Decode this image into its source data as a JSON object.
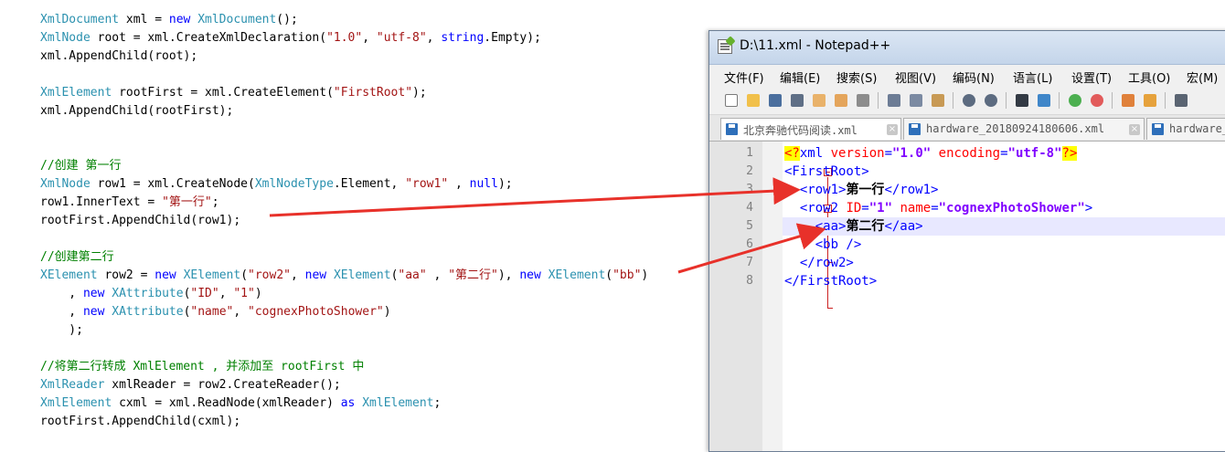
{
  "code_editor": {
    "lines": [
      [
        {
          "c": "type",
          "t": "XmlDocument"
        },
        {
          "c": "txt",
          "t": " xml = "
        },
        {
          "c": "kw",
          "t": "new"
        },
        {
          "c": "txt",
          "t": " "
        },
        {
          "c": "type",
          "t": "XmlDocument"
        },
        {
          "c": "txt",
          "t": "();"
        }
      ],
      [
        {
          "c": "type",
          "t": "XmlNode"
        },
        {
          "c": "txt",
          "t": " root = xml.CreateXmlDeclaration("
        },
        {
          "c": "str",
          "t": "\"1.0\""
        },
        {
          "c": "txt",
          "t": ", "
        },
        {
          "c": "str",
          "t": "\"utf-8\""
        },
        {
          "c": "txt",
          "t": ", "
        },
        {
          "c": "kw",
          "t": "string"
        },
        {
          "c": "txt",
          "t": ".Empty);"
        }
      ],
      [
        {
          "c": "txt",
          "t": "xml.AppendChild(root);"
        }
      ],
      [],
      [
        {
          "c": "type",
          "t": "XmlElement"
        },
        {
          "c": "txt",
          "t": " rootFirst = xml.CreateElement("
        },
        {
          "c": "str",
          "t": "\"FirstRoot\""
        },
        {
          "c": "txt",
          "t": ");"
        }
      ],
      [
        {
          "c": "txt",
          "t": "xml.AppendChild(rootFirst);"
        }
      ],
      [],
      [],
      [
        {
          "c": "cmt",
          "t": "//创建 第一行"
        }
      ],
      [
        {
          "c": "type",
          "t": "XmlNode"
        },
        {
          "c": "txt",
          "t": " row1 = xml.CreateNode("
        },
        {
          "c": "type",
          "t": "XmlNodeType"
        },
        {
          "c": "txt",
          "t": ".Element, "
        },
        {
          "c": "str",
          "t": "\"row1\""
        },
        {
          "c": "txt",
          "t": " , "
        },
        {
          "c": "kw",
          "t": "null"
        },
        {
          "c": "txt",
          "t": ");"
        }
      ],
      [
        {
          "c": "txt",
          "t": "row1.InnerText = "
        },
        {
          "c": "str",
          "t": "\"第一行\""
        },
        {
          "c": "txt",
          "t": ";"
        }
      ],
      [
        {
          "c": "txt",
          "t": "rootFirst.AppendChild(row1);"
        }
      ],
      [],
      [
        {
          "c": "cmt",
          "t": "//创建第二行"
        }
      ],
      [
        {
          "c": "type",
          "t": "XElement"
        },
        {
          "c": "txt",
          "t": " row2 = "
        },
        {
          "c": "kw",
          "t": "new"
        },
        {
          "c": "txt",
          "t": " "
        },
        {
          "c": "type",
          "t": "XElement"
        },
        {
          "c": "txt",
          "t": "("
        },
        {
          "c": "str",
          "t": "\"row2\""
        },
        {
          "c": "txt",
          "t": ", "
        },
        {
          "c": "kw",
          "t": "new"
        },
        {
          "c": "txt",
          "t": " "
        },
        {
          "c": "type",
          "t": "XElement"
        },
        {
          "c": "txt",
          "t": "("
        },
        {
          "c": "str",
          "t": "\"aa\""
        },
        {
          "c": "txt",
          "t": " , "
        },
        {
          "c": "str",
          "t": "\"第二行\""
        },
        {
          "c": "txt",
          "t": "), "
        },
        {
          "c": "kw",
          "t": "new"
        },
        {
          "c": "txt",
          "t": " "
        },
        {
          "c": "type",
          "t": "XElement"
        },
        {
          "c": "txt",
          "t": "("
        },
        {
          "c": "str",
          "t": "\"bb\""
        },
        {
          "c": "txt",
          "t": ")"
        }
      ],
      [
        {
          "c": "txt",
          "t": "    , "
        },
        {
          "c": "kw",
          "t": "new"
        },
        {
          "c": "txt",
          "t": " "
        },
        {
          "c": "type",
          "t": "XAttribute"
        },
        {
          "c": "txt",
          "t": "("
        },
        {
          "c": "str",
          "t": "\"ID\""
        },
        {
          "c": "txt",
          "t": ", "
        },
        {
          "c": "str",
          "t": "\"1\""
        },
        {
          "c": "txt",
          "t": ")"
        }
      ],
      [
        {
          "c": "txt",
          "t": "    , "
        },
        {
          "c": "kw",
          "t": "new"
        },
        {
          "c": "txt",
          "t": " "
        },
        {
          "c": "type",
          "t": "XAttribute"
        },
        {
          "c": "txt",
          "t": "("
        },
        {
          "c": "str",
          "t": "\"name\""
        },
        {
          "c": "txt",
          "t": ", "
        },
        {
          "c": "str",
          "t": "\"cognexPhotoShower\""
        },
        {
          "c": "txt",
          "t": ")"
        }
      ],
      [
        {
          "c": "txt",
          "t": "    );"
        }
      ],
      [],
      [
        {
          "c": "cmt",
          "t": "//将第二行转成 XmlElement , 并添加至 rootFirst 中"
        }
      ],
      [
        {
          "c": "type",
          "t": "XmlReader"
        },
        {
          "c": "txt",
          "t": " xmlReader = row2.CreateReader();"
        }
      ],
      [
        {
          "c": "type",
          "t": "XmlElement"
        },
        {
          "c": "txt",
          "t": " cxml = xml.ReadNode(xmlReader) "
        },
        {
          "c": "kw",
          "t": "as"
        },
        {
          "c": "txt",
          "t": " "
        },
        {
          "c": "type",
          "t": "XmlElement"
        },
        {
          "c": "txt",
          "t": ";"
        }
      ],
      [
        {
          "c": "txt",
          "t": "rootFirst.AppendChild(cxml);"
        }
      ]
    ]
  },
  "notepad": {
    "title": "D:\\11.xml - Notepad++",
    "menu": [
      "文件(F)",
      "编辑(E)",
      "搜索(S)",
      "视图(V)",
      "编码(N)",
      "语言(L)",
      "设置(T)",
      "工具(O)",
      "宏(M)"
    ],
    "toolbar_icons": [
      "new-file-icon",
      "open-file-icon",
      "save-icon",
      "save-all-icon",
      "close-icon",
      "close-all-icon",
      "print-icon",
      "cut-icon",
      "copy-icon",
      "paste-icon",
      "undo-icon",
      "redo-icon",
      "find-icon",
      "replace-icon",
      "zoom-in-icon",
      "zoom-out-icon",
      "sync-v-icon",
      "sync-h-icon",
      "wrap-icon"
    ],
    "tabs": [
      {
        "label": "北京奔驰代码阅读.xml",
        "close": "×"
      },
      {
        "label": "hardware_20180924180606.xml",
        "close": "×"
      },
      {
        "label": "hardware_"
      }
    ],
    "line_numbers": [
      "1",
      "2",
      "3",
      "4",
      "5",
      "6",
      "7",
      "8"
    ],
    "xml_lines": [
      [
        {
          "c": "decl",
          "t": "<?"
        },
        {
          "c": "tag",
          "t": "xml"
        },
        {
          "c": "txt",
          "t": " "
        },
        {
          "c": "attr",
          "t": "version"
        },
        {
          "c": "tag",
          "t": "="
        },
        {
          "c": "val",
          "t": "\"1.0\""
        },
        {
          "c": "txt",
          "t": " "
        },
        {
          "c": "attr",
          "t": "encoding"
        },
        {
          "c": "tag",
          "t": "="
        },
        {
          "c": "val",
          "t": "\"utf-8\""
        },
        {
          "c": "decl",
          "t": "?>"
        }
      ],
      [
        {
          "c": "tag",
          "t": "<FirstRoot>"
        }
      ],
      [
        {
          "c": "txt",
          "t": "  "
        },
        {
          "c": "tag",
          "t": "<row1>"
        },
        {
          "c": "text",
          "t": "第一行"
        },
        {
          "c": "tag",
          "t": "</row1>"
        }
      ],
      [
        {
          "c": "txt",
          "t": "  "
        },
        {
          "c": "tag",
          "t": "<row2 "
        },
        {
          "c": "attr",
          "t": "ID"
        },
        {
          "c": "tag",
          "t": "="
        },
        {
          "c": "val",
          "t": "\"1\""
        },
        {
          "c": "txt",
          "t": " "
        },
        {
          "c": "attr",
          "t": "name"
        },
        {
          "c": "tag",
          "t": "="
        },
        {
          "c": "val",
          "t": "\"cognexPhotoShower\""
        },
        {
          "c": "tag",
          "t": ">"
        }
      ],
      [
        {
          "c": "txt",
          "t": "    "
        },
        {
          "c": "tag",
          "t": "<aa>"
        },
        {
          "c": "text",
          "t": "第二行"
        },
        {
          "c": "tag",
          "t": "</aa>"
        }
      ],
      [
        {
          "c": "txt",
          "t": "    "
        },
        {
          "c": "tag",
          "t": "<bb />"
        }
      ],
      [
        {
          "c": "txt",
          "t": "  "
        },
        {
          "c": "tag",
          "t": "</row2>"
        }
      ],
      [
        {
          "c": "tag",
          "t": "</FirstRoot>"
        }
      ]
    ]
  },
  "colors": {
    "arrow": "#e8312a",
    "code_type": "#2b91af",
    "code_keyword": "#0000ff",
    "code_string": "#a31515",
    "code_comment": "#008000"
  }
}
